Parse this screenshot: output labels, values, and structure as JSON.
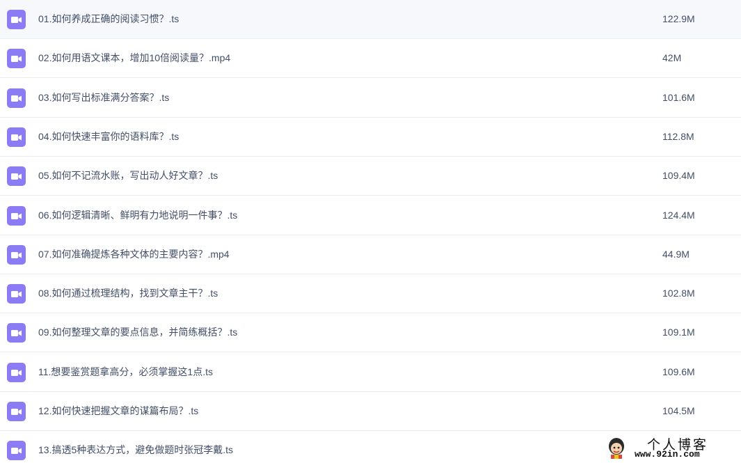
{
  "files": [
    {
      "name": "01.如何养成正确的阅读习惯？.ts",
      "size": "122.9M",
      "icon": "video-file-icon"
    },
    {
      "name": "02.如何用语文课本，增加10倍阅读量？.mp4",
      "size": "42M",
      "icon": "video-file-icon"
    },
    {
      "name": "03.如何写出标准满分答案？.ts",
      "size": "101.6M",
      "icon": "video-file-icon"
    },
    {
      "name": "04.如何快速丰富你的语料库？.ts",
      "size": "112.8M",
      "icon": "video-file-icon"
    },
    {
      "name": "05.如何不记流水账，写出动人好文章？.ts",
      "size": "109.4M",
      "icon": "video-file-icon"
    },
    {
      "name": "06.如何逻辑清晰、鲜明有力地说明一件事？.ts",
      "size": "124.4M",
      "icon": "video-file-icon"
    },
    {
      "name": "07.如何准确提炼各种文体的主要内容？.mp4",
      "size": "44.9M",
      "icon": "video-file-icon"
    },
    {
      "name": "08.如何通过梳理结构，找到文章主干？.ts",
      "size": "102.8M",
      "icon": "video-file-icon"
    },
    {
      "name": "09.如何整理文章的要点信息，并简练概括？.ts",
      "size": "109.1M",
      "icon": "video-file-icon"
    },
    {
      "name": "11.想要鉴赏题拿高分，必须掌握这1点.ts",
      "size": "109.6M",
      "icon": "video-file-icon"
    },
    {
      "name": "12.如何快速把握文章的谋篇布局？.ts",
      "size": "104.5M",
      "icon": "video-file-icon"
    },
    {
      "name": "13.搞透5种表达方式，避免做题时张冠李戴.ts",
      "size": "",
      "icon": "video-file-icon"
    }
  ],
  "watermark": {
    "title": "个人博客",
    "url": "www.92in.com"
  },
  "colors": {
    "icon": "#8b7cf6",
    "text": "#424e67",
    "divider": "#ededf0"
  }
}
